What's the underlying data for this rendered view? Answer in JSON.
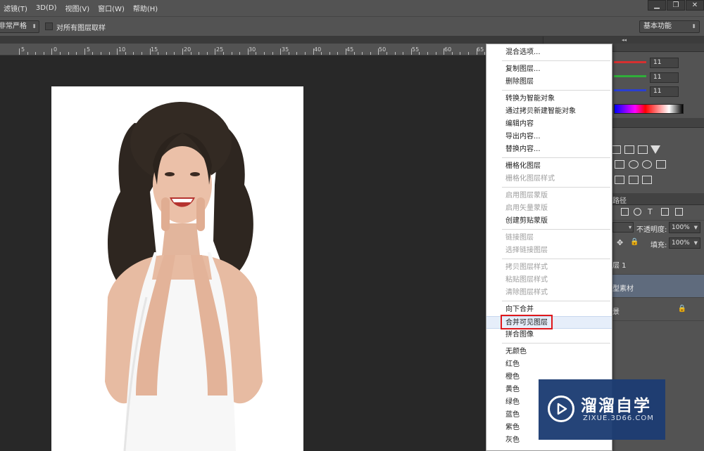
{
  "menubar": {
    "items": [
      "滤镜(T)",
      "3D(D)",
      "视图(V)",
      "窗口(W)",
      "帮助(H)"
    ],
    "window_controls": [
      "▁",
      "❐",
      "✕"
    ]
  },
  "options": {
    "sample_mode": "非常严格",
    "sample_all_layers_label": "对所有图层取样",
    "workspace": "基本功能"
  },
  "ruler": {
    "labels": [
      "5",
      "0",
      "5",
      "10",
      "15",
      "20",
      "25",
      "30",
      "35",
      "40",
      "45",
      "50",
      "55",
      "60",
      "65"
    ]
  },
  "color_panel": {
    "r_value": "11",
    "g_value": "11",
    "b_value": "11",
    "colors": {
      "r": "#d63030",
      "g": "#2fae3a",
      "b": "#2a3fd0"
    }
  },
  "layers_panel": {
    "tab_paths": "路径",
    "kind_select": "▾",
    "opacity_label": "不透明度:",
    "opacity_value": "100%",
    "fill_label": "填充:",
    "fill_value": "100%",
    "layers": [
      {
        "name": "层 1",
        "selected": false,
        "locked": false
      },
      {
        "name": "型素材",
        "selected": true,
        "locked": false
      },
      {
        "name": "景",
        "selected": false,
        "locked": true
      }
    ]
  },
  "context_menu": {
    "items": [
      {
        "label": "混合选项...",
        "enabled": true
      },
      {
        "label": "复制图层...",
        "enabled": true
      },
      {
        "label": "删除图层",
        "enabled": true
      },
      {
        "label": "转换为智能对象",
        "enabled": true
      },
      {
        "label": "通过拷贝新建智能对象",
        "enabled": true
      },
      {
        "label": "编辑内容",
        "enabled": true
      },
      {
        "label": "导出内容...",
        "enabled": true
      },
      {
        "label": "替换内容...",
        "enabled": true
      },
      {
        "label": "栅格化图层",
        "enabled": true
      },
      {
        "label": "栅格化图层样式",
        "enabled": false
      },
      {
        "label": "启用图层蒙版",
        "enabled": false
      },
      {
        "label": "启用矢量蒙版",
        "enabled": false
      },
      {
        "label": "创建剪贴蒙版",
        "enabled": true
      },
      {
        "label": "链接图层",
        "enabled": false
      },
      {
        "label": "选择链接图层",
        "enabled": false
      },
      {
        "label": "拷贝图层样式",
        "enabled": false
      },
      {
        "label": "粘贴图层样式",
        "enabled": false
      },
      {
        "label": "清除图层样式",
        "enabled": false
      },
      {
        "label": "向下合并",
        "enabled": true
      },
      {
        "label": "合并可见图层",
        "enabled": true,
        "highlighted": true
      },
      {
        "label": "拼合图像",
        "enabled": true
      },
      {
        "label": "无颜色",
        "enabled": true
      },
      {
        "label": "红色",
        "enabled": true
      },
      {
        "label": "橙色",
        "enabled": true
      },
      {
        "label": "黄色",
        "enabled": true
      },
      {
        "label": "绿色",
        "enabled": true
      },
      {
        "label": "蓝色",
        "enabled": true
      },
      {
        "label": "紫色",
        "enabled": true
      },
      {
        "label": "灰色",
        "enabled": true
      }
    ]
  },
  "watermark": {
    "title": "溜溜自学",
    "subtitle": "ZIXUE.3D66.COM",
    "color": "#1d3d73"
  }
}
